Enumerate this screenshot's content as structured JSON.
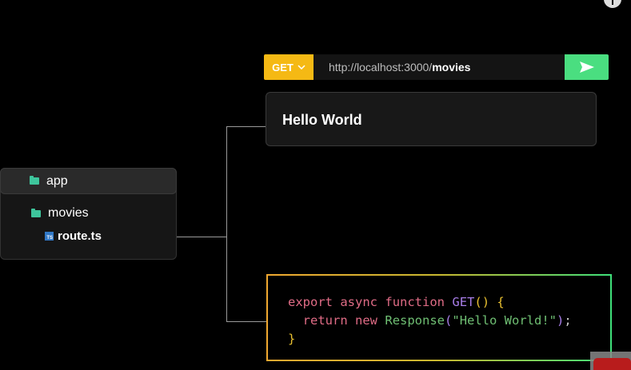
{
  "request": {
    "method": "GET",
    "url_base": "http://localhost:3000/",
    "url_path": "movies"
  },
  "response": {
    "text": "Hello World"
  },
  "file_tree": {
    "root": "app",
    "folder": "movies",
    "file": "route.ts",
    "file_badge": "TS"
  },
  "code": {
    "l1_export": "export",
    "l1_async": "async",
    "l1_function": "function",
    "l1_name": "GET",
    "l1_parens": "()",
    "l1_brace": "{",
    "l2_return": "return",
    "l2_new": "new",
    "l2_class": "Response",
    "l2_open": "(",
    "l2_string": "\"Hello World!\"",
    "l2_close": ")",
    "l2_semi": ";",
    "l3_brace": "}"
  },
  "colors": {
    "method": "#f5b914",
    "send": "#4ade80",
    "folder": "#3ec59c"
  }
}
